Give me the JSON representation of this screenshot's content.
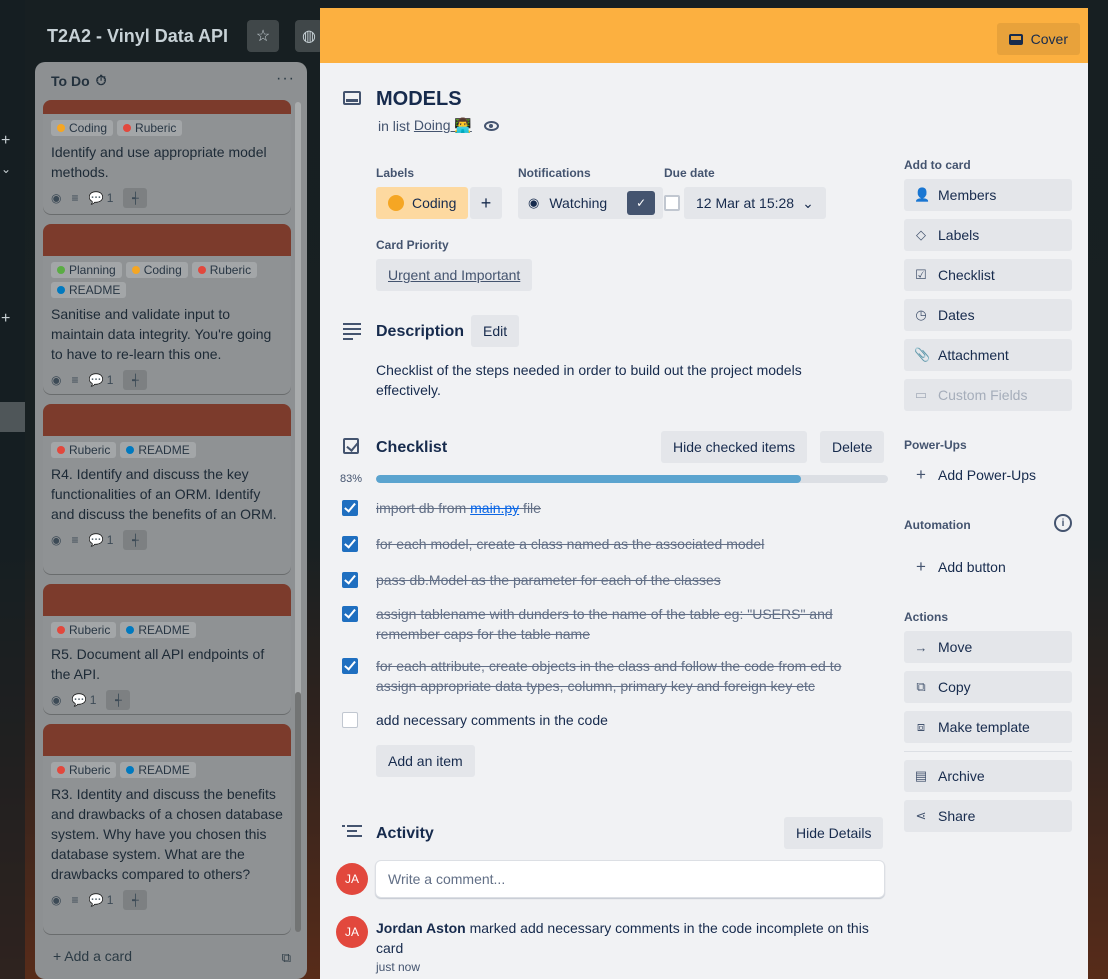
{
  "board": {
    "title": "T2A2 - Vinyl Data API",
    "list": {
      "title": "To Do",
      "add_card": "Add a card",
      "cards": [
        {
          "labels": [
            {
              "name": "Coding",
              "color": "#f5a623"
            },
            {
              "name": "Ruberic",
              "color": "#e2483d"
            }
          ],
          "text": "Identify and use appropriate model methods.",
          "comments": "1"
        },
        {
          "labels": [
            {
              "name": "Planning",
              "color": "#5aac44"
            },
            {
              "name": "Coding",
              "color": "#f5a623"
            },
            {
              "name": "Ruberic",
              "color": "#e2483d"
            },
            {
              "name": "README",
              "color": "#0079bf"
            }
          ],
          "text": "Sanitise and validate input to maintain data integrity. You're going to have to re-learn this one.",
          "comments": "1"
        },
        {
          "labels": [
            {
              "name": "Ruberic",
              "color": "#e2483d"
            },
            {
              "name": "README",
              "color": "#0079bf"
            }
          ],
          "text": "R4. Identify and discuss the key functionalities of an ORM. Identify and discuss the benefits of an ORM.",
          "comments": "1"
        },
        {
          "labels": [
            {
              "name": "Ruberic",
              "color": "#e2483d"
            },
            {
              "name": "README",
              "color": "#0079bf"
            }
          ],
          "text": "R5. Document all API endpoints of the API.",
          "comments": "1"
        },
        {
          "labels": [
            {
              "name": "Ruberic",
              "color": "#e2483d"
            },
            {
              "name": "README",
              "color": "#0079bf"
            }
          ],
          "text": "R3. Identity and discuss the benefits and drawbacks of a chosen database system. Why have you chosen this database system. What are the drawbacks compared to others?",
          "comments": "1"
        }
      ]
    }
  },
  "card": {
    "cover_button": "Cover",
    "title": "MODELS",
    "in_list_prefix": "in list",
    "list_name": "Doing 👨‍💻",
    "labels_heading": "Labels",
    "label": "Coding",
    "label_color": "#f5a623",
    "notifications_heading": "Notifications",
    "watching": "Watching",
    "due_heading": "Due date",
    "due_date": "12 Mar at 15:28",
    "priority_heading": "Card Priority",
    "priority": "Urgent and Important",
    "description_heading": "Description",
    "edit_button": "Edit",
    "description": "Checklist of the steps needed in order to build out the project models effectively.",
    "checklist_heading": "Checklist",
    "hide_checked": "Hide checked items",
    "delete": "Delete",
    "progress_label": "83%",
    "progress": 0.83,
    "checklist_items": [
      {
        "checked": true,
        "pre": "import db from ",
        "link": "main.py",
        "post": " file"
      },
      {
        "checked": true,
        "pre": "for each model, create a class named as the associated model",
        "link": "",
        "post": ""
      },
      {
        "checked": true,
        "pre": "pass db.Model as the parameter for each of the classes",
        "link": "",
        "post": ""
      },
      {
        "checked": true,
        "pre": "assign tablename with dunders to the name of the table eg: \"USERS\" and remember caps for the table name",
        "link": "",
        "post": ""
      },
      {
        "checked": true,
        "pre": "for each attribute, create objects in the class and follow the code from ed to assign appropriate data types, column, primary key and foreign key etc",
        "link": "",
        "post": ""
      },
      {
        "checked": false,
        "pre": "add necessary comments in the code",
        "link": "",
        "post": ""
      }
    ],
    "add_item": "Add an item",
    "activity_heading": "Activity",
    "hide_details": "Hide Details",
    "avatar_initials": "JA",
    "comment_placeholder": "Write a comment...",
    "activity": {
      "user": "Jordan Aston",
      "action": " marked add necessary comments in the code incomplete on this card",
      "time": "just now"
    }
  },
  "sidebar": {
    "add_to_card_heading": "Add to card",
    "add_to_card": [
      {
        "label": "Members",
        "icon": "person-icon"
      },
      {
        "label": "Labels",
        "icon": "tag-icon"
      },
      {
        "label": "Checklist",
        "icon": "checklist-icon"
      },
      {
        "label": "Dates",
        "icon": "clock-icon"
      },
      {
        "label": "Attachment",
        "icon": "paperclip-icon"
      },
      {
        "label": "Custom Fields",
        "icon": "custom-fields-icon"
      }
    ],
    "powerups_heading": "Power-Ups",
    "add_powerups": "Add Power-Ups",
    "automation_heading": "Automation",
    "add_button": "Add button",
    "actions_heading": "Actions",
    "actions": [
      {
        "label": "Move",
        "icon": "arrow-right-icon"
      },
      {
        "label": "Copy",
        "icon": "copy-icon"
      },
      {
        "label": "Make template",
        "icon": "template-icon"
      },
      {
        "label": "Archive",
        "icon": "archive-icon"
      },
      {
        "label": "Share",
        "icon": "share-icon"
      }
    ]
  }
}
